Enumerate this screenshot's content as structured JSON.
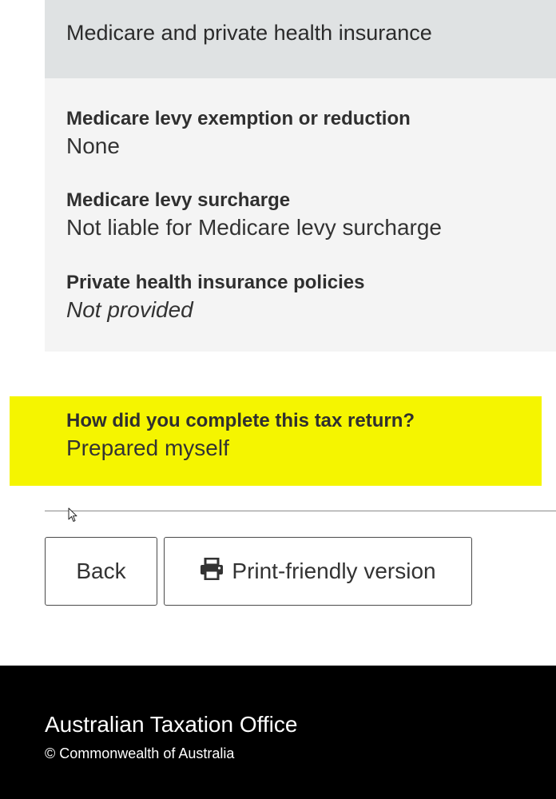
{
  "section": {
    "title": "Medicare and private health insurance",
    "fields": [
      {
        "label": "Medicare levy exemption or reduction",
        "value": "None"
      },
      {
        "label": "Medicare levy surcharge",
        "value": "Not liable for Medicare levy surcharge"
      },
      {
        "label": "Private health insurance policies",
        "value": "Not provided"
      }
    ]
  },
  "completion": {
    "label": "How did you complete this tax return?",
    "value": "Prepared myself",
    "highlight_color": "#f5f500"
  },
  "buttons": {
    "back_label": "Back",
    "print_label": "Print-friendly version",
    "print_icon": "printer-icon"
  },
  "footer": {
    "title": "Australian Taxation Office",
    "copyright": "© Commonwealth of Australia"
  }
}
